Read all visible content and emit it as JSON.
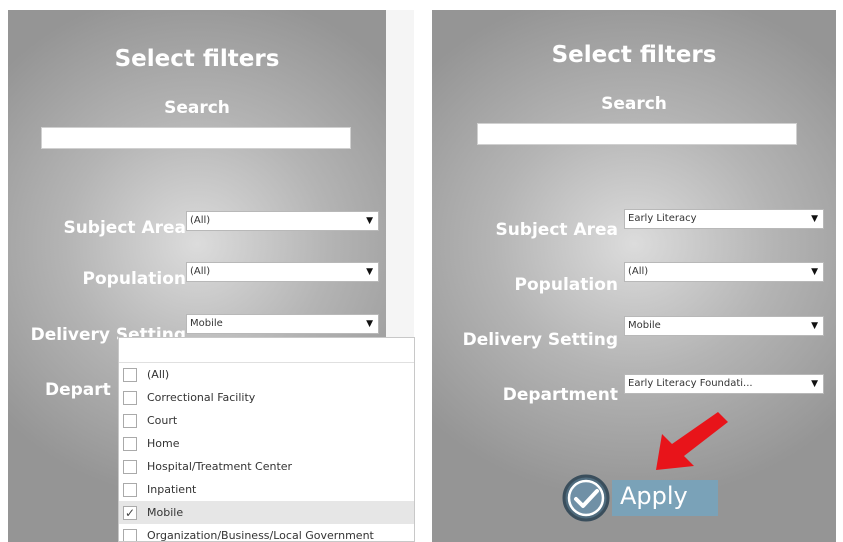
{
  "left_panel": {
    "title": "Select filters",
    "search_label": "Search",
    "search_value": "",
    "filters": [
      {
        "label": "Subject Area",
        "value": "(All)"
      },
      {
        "label": "Population",
        "value": "(All)"
      },
      {
        "label": "Delivery Setting",
        "value": "Mobile"
      },
      {
        "label": "Depart",
        "value": ""
      }
    ],
    "dropdown_options": [
      {
        "label": "(All)",
        "checked": false
      },
      {
        "label": "Correctional Facility",
        "checked": false
      },
      {
        "label": "Court",
        "checked": false
      },
      {
        "label": "Home",
        "checked": false
      },
      {
        "label": "Hospital/Treatment Center",
        "checked": false
      },
      {
        "label": "Inpatient",
        "checked": false
      },
      {
        "label": "Mobile",
        "checked": true
      },
      {
        "label": "Organization/Business/Local Government",
        "checked": false
      }
    ]
  },
  "right_panel": {
    "title": "Select filters",
    "search_label": "Search",
    "search_value": "",
    "filters": [
      {
        "label": "Subject Area",
        "value": "Early Literacy"
      },
      {
        "label": "Population",
        "value": "(All)"
      },
      {
        "label": "Delivery Setting",
        "value": "Mobile"
      },
      {
        "label": "Department",
        "value": "Early Literacy Foundati..."
      }
    ],
    "apply_label": "Apply"
  },
  "icons": {
    "dropdown_arrow": "▼",
    "checkmark": "✓",
    "apply_icon": "check-circle-icon",
    "annotation": "red-arrow-icon"
  },
  "colors": {
    "apply_bg": "#7aa2b8",
    "annotation": "#e8141a"
  }
}
